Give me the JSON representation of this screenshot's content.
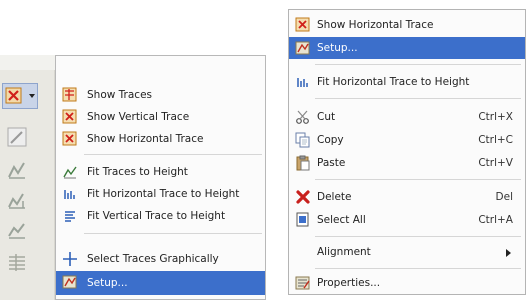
{
  "left_menu": {
    "items": [
      {
        "label": "Show Traces",
        "icon": "show-traces-icon"
      },
      {
        "label": "Show Vertical Trace",
        "icon": "show-vertical-trace-icon"
      },
      {
        "label": "Show Horizontal Trace",
        "icon": "show-horizontal-trace-icon"
      },
      {
        "label": "Fit Traces to Height",
        "icon": "fit-traces-icon"
      },
      {
        "label": "Fit Horizontal Trace to Height",
        "icon": "fit-horizontal-trace-icon"
      },
      {
        "label": "Fit Vertical Trace to Height",
        "icon": "fit-vertical-trace-icon"
      },
      {
        "label": "Select Traces Graphically",
        "icon": "crosshair-icon"
      },
      {
        "label": "Setup...",
        "icon": "setup-icon",
        "selected": true
      }
    ]
  },
  "right_menu": {
    "items": [
      {
        "label": "Show Horizontal Trace",
        "shortcut": "",
        "icon": "show-horizontal-trace-icon"
      },
      {
        "label": "Setup...",
        "shortcut": "",
        "icon": "setup-icon",
        "selected": true
      },
      {
        "label": "Fit Horizontal Trace to Height",
        "shortcut": "",
        "icon": "fit-horizontal-trace-icon"
      },
      {
        "label": "Cut",
        "shortcut": "Ctrl+X",
        "icon": "scissors-icon"
      },
      {
        "label": "Copy",
        "shortcut": "Ctrl+C",
        "icon": "copy-icon"
      },
      {
        "label": "Paste",
        "shortcut": "Ctrl+V",
        "icon": "paste-icon"
      },
      {
        "label": "Delete",
        "shortcut": "Del",
        "icon": "delete-icon"
      },
      {
        "label": "Select All",
        "shortcut": "Ctrl+A",
        "icon": "select-all-icon"
      },
      {
        "label": "Alignment",
        "shortcut": "",
        "icon": "",
        "submenu": true
      },
      {
        "label": "Properties...",
        "shortcut": "",
        "icon": "properties-icon"
      }
    ]
  },
  "colors": {
    "highlight": "#3c6fcb",
    "menu_bg": "#fbfbfb",
    "delete_red": "#c8201d"
  }
}
